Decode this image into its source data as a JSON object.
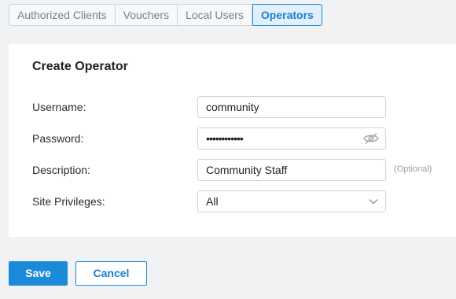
{
  "tabs": [
    {
      "label": "Authorized Clients",
      "active": false
    },
    {
      "label": "Vouchers",
      "active": false
    },
    {
      "label": "Local Users",
      "active": false
    },
    {
      "label": "Operators",
      "active": true
    }
  ],
  "form": {
    "title": "Create Operator",
    "username": {
      "label": "Username:",
      "value": "community"
    },
    "password": {
      "label": "Password:",
      "value": "••••••••••••",
      "icon": "eye-slash-icon"
    },
    "description": {
      "label": "Description:",
      "value": "Community Staff",
      "hint": "(Optional)"
    },
    "site_privileges": {
      "label": "Site Privileges:",
      "value": "All",
      "icon": "chevron-down-icon"
    }
  },
  "actions": {
    "save_label": "Save",
    "cancel_label": "Cancel"
  },
  "colors": {
    "accent": "#1b8ad8",
    "page_background": "#f1f2f4",
    "panel_background": "#ffffff"
  }
}
